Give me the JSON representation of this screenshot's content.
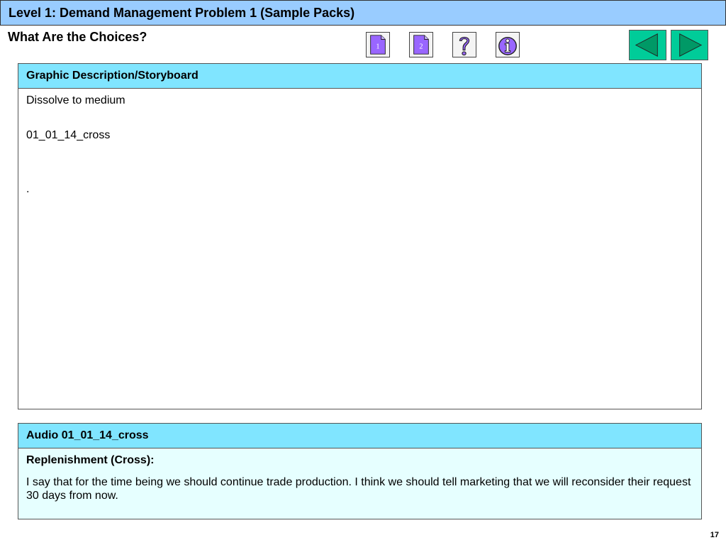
{
  "header": {
    "title": "Level 1: Demand Management Problem 1 (Sample Packs)",
    "subtitle": "What Are the Choices?"
  },
  "nav": {
    "page1_label": "1",
    "page2_label": "2",
    "icons": [
      "document-1-icon",
      "document-2-icon",
      "help-icon",
      "info-icon",
      "back-arrow-icon",
      "forward-arrow-icon"
    ]
  },
  "graphic_panel": {
    "header": "Graphic Description/Storyboard",
    "line1": "Dissolve to medium",
    "line2": "01_01_14_cross",
    "line3": "."
  },
  "audio_panel": {
    "header": "Audio 01_01_14_cross",
    "heading": "Replenishment (Cross):",
    "text": "I say that for the time being we should continue trade production. I think we should tell marketing that we will reconsider their request 30 days from now."
  },
  "footer": {
    "page_number": "17"
  },
  "colors": {
    "title_bar": "#99ccff",
    "panel_header": "#80e5ff",
    "audio_body": "#e6ffff",
    "nav_icon_purple": "#9966ff",
    "arrow_button": "#00cc99",
    "arrow_fill": "#009966"
  }
}
